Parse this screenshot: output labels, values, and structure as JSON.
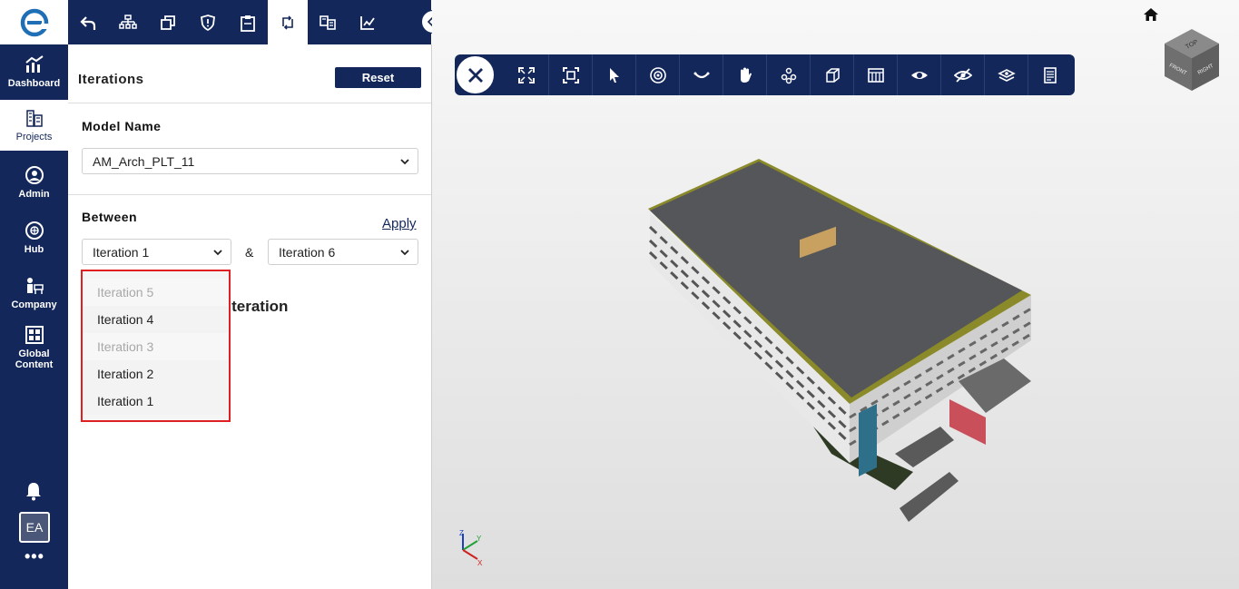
{
  "nav": {
    "items": [
      {
        "label": "Dashboard"
      },
      {
        "label": "Projects"
      },
      {
        "label": "Admin"
      },
      {
        "label": "Hub"
      },
      {
        "label": "Company"
      },
      {
        "label": "Global Content"
      }
    ],
    "avatar_initials": "EA",
    "more_label": "•••"
  },
  "panel": {
    "title": "Iterations",
    "reset_label": "Reset",
    "model_name_label": "Model Name",
    "model_name_value": "AM_Arch_PLT_11",
    "between_label": "Between",
    "apply_label": "Apply",
    "from_value": "Iteration 1",
    "amp": "&",
    "to_value": "Iteration 6",
    "background_text": "t Iteration"
  },
  "dropdown": {
    "options": [
      {
        "label": "Iteration 5",
        "state": "disabled"
      },
      {
        "label": "Iteration 4",
        "state": "enabled"
      },
      {
        "label": "Iteration 3",
        "state": "disabled"
      },
      {
        "label": "Iteration 2",
        "state": "enabled"
      },
      {
        "label": "Iteration 1",
        "state": "enabled"
      }
    ],
    "highlight_color": "#e02020"
  },
  "viewcube": {
    "top": "TOP",
    "front": "FRONT",
    "right": "RIGHT"
  },
  "axes": {
    "x": "X",
    "y": "Y",
    "z": "Z"
  },
  "colors": {
    "brand": "#13275a",
    "accent_red": "#e02020"
  }
}
